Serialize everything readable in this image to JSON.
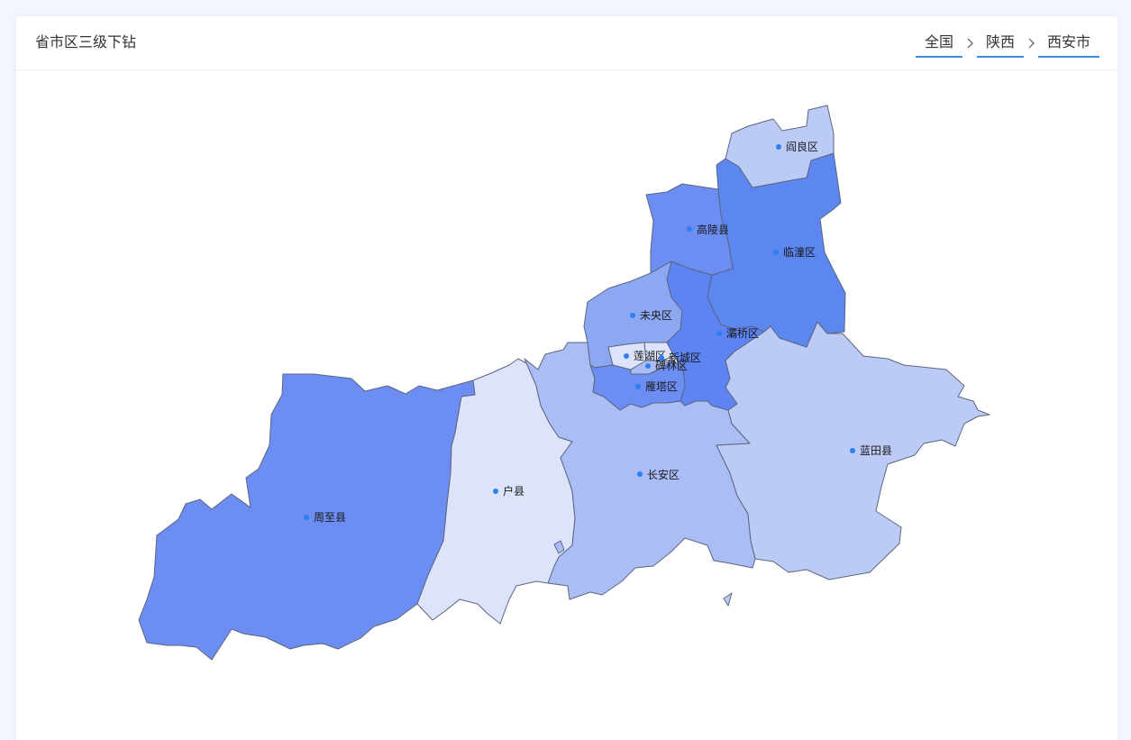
{
  "header": {
    "title": "省市区三级下钻"
  },
  "breadcrumb": {
    "items": [
      {
        "label": "全国"
      },
      {
        "label": "陕西"
      },
      {
        "label": "西安市"
      }
    ]
  },
  "colors": {
    "level_1": "#dde3fb",
    "level_2": "#bccbf6",
    "level_3": "#aabdf5",
    "level_4": "#8da8f2",
    "level_5": "#6c8df2",
    "level_6": "#5d84f2",
    "level_7": "#5c86f0",
    "point": "#2f7ff0",
    "accent": "#3a8ee6"
  },
  "map": {
    "regions": [
      {
        "id": "yanliang",
        "name": "阎良区",
        "level": 2
      },
      {
        "id": "lintong",
        "name": "临潼区",
        "level": 7
      },
      {
        "id": "gaoling",
        "name": "高陵县",
        "level": 5
      },
      {
        "id": "weiyang",
        "name": "未央区",
        "level": 4
      },
      {
        "id": "baqiao",
        "name": "灞桥区",
        "level": 6
      },
      {
        "id": "lianhu",
        "name": "莲湖区",
        "level": 1
      },
      {
        "id": "xincheng",
        "name": "新城区",
        "level": 1
      },
      {
        "id": "beilin",
        "name": "碑林区",
        "level": 3
      },
      {
        "id": "yanta",
        "name": "雁塔区",
        "level": 5
      },
      {
        "id": "changan",
        "name": "长安区",
        "level": 3
      },
      {
        "id": "lantian",
        "name": "蓝田县",
        "level": 2
      },
      {
        "id": "huxian",
        "name": "户县",
        "level": 1
      },
      {
        "id": "zhouzhi",
        "name": "周至县",
        "level": 5
      }
    ]
  }
}
